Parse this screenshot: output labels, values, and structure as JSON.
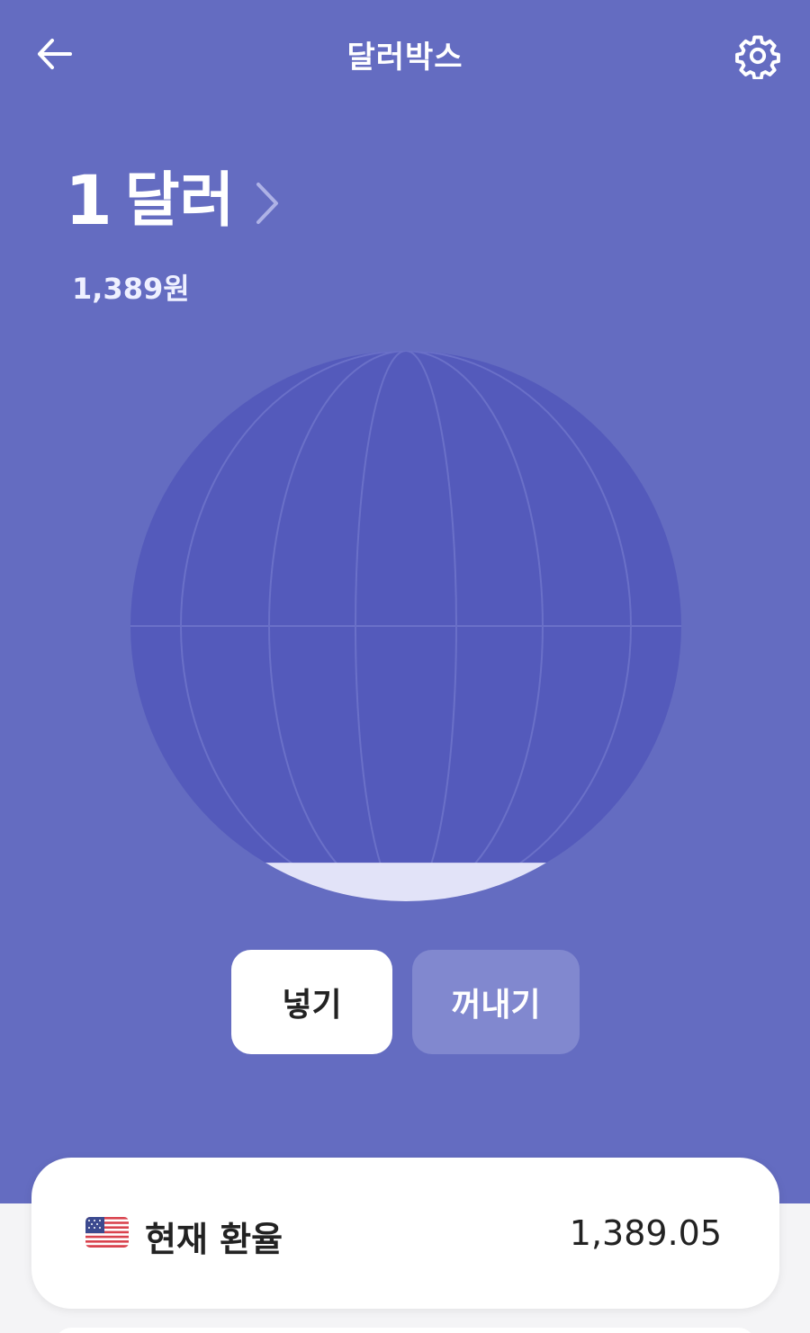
{
  "header": {
    "title": "달러박스",
    "back_icon": "arrow-left-icon",
    "settings_icon": "gear-icon"
  },
  "balance": {
    "amount": "1",
    "unit": "달러",
    "krw_equivalent": "1,389원"
  },
  "fill_level": 0.07,
  "actions": {
    "deposit_label": "넣기",
    "withdraw_label": "꺼내기"
  },
  "exchange_rate": {
    "label": "현재 환율",
    "value": "1,389.05",
    "flag_icon": "us-flag-icon"
  },
  "colors": {
    "hero_bg": "#646cc1",
    "globe_fill": "#545abb",
    "liquid_fill": "#e2e3f8",
    "withdraw_btn": "#8188cf"
  }
}
